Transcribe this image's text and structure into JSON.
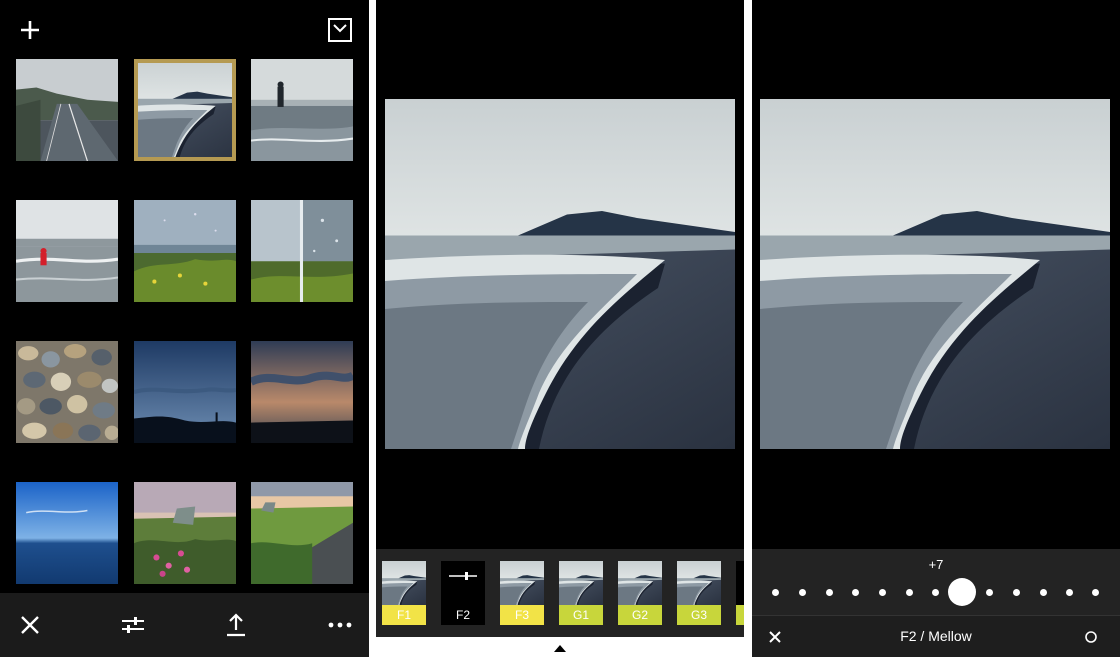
{
  "library": {
    "add_icon": "plus-icon",
    "store_icon": "shop-bag-icon",
    "thumbnails": [
      "road",
      "beach-selected",
      "person-on-beach",
      "child-on-beach",
      "rainy-field",
      "rain-window",
      "pebbles",
      "dusk-sky",
      "sunset-clouds",
      "blue-sea",
      "flowers-boat",
      "boat-field"
    ],
    "toolbar": [
      "close-icon",
      "adjust-icon",
      "share-icon",
      "more-icon"
    ]
  },
  "editor": {
    "presets": [
      {
        "label": "F1",
        "color": "#f2e347"
      },
      {
        "label": "F2",
        "color": "#000000",
        "active": true
      },
      {
        "label": "F3",
        "color": "#f2e347"
      },
      {
        "label": "G1",
        "color": "#c8d63b"
      },
      {
        "label": "G2",
        "color": "#c8d63b"
      },
      {
        "label": "G3",
        "color": "#c8d63b"
      }
    ]
  },
  "adjust": {
    "value_label": "+7",
    "preset_name": "F2 / Mellow",
    "slider": {
      "steps": 13,
      "position": 7
    }
  }
}
